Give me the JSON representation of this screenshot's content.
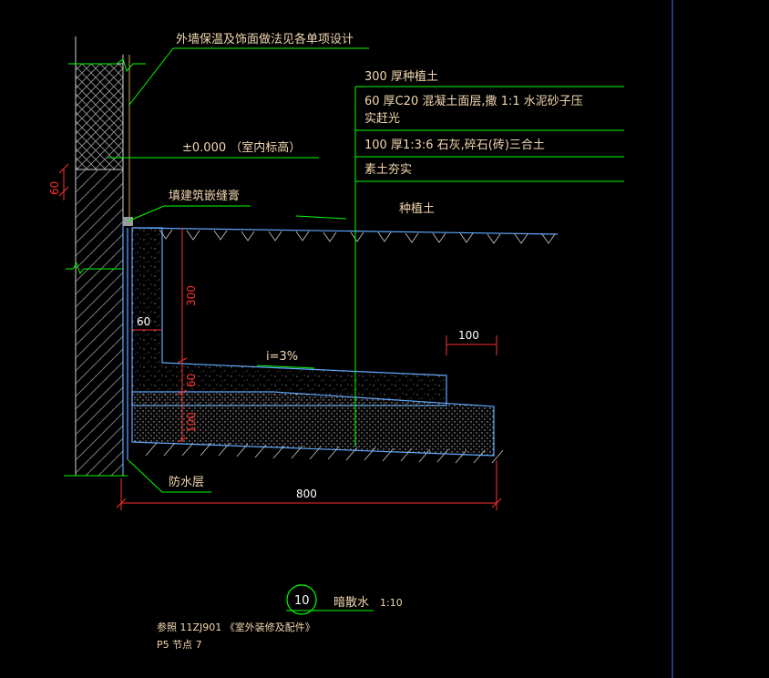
{
  "notes": {
    "wall_finish": "外墙保温及饰面做法见各单项设计",
    "floor_level": "±0.000 （室内标高）",
    "joint": "填建筑嵌缝膏",
    "waterproof": "防水层",
    "planting_soil": "种植土",
    "slope": "i=3%"
  },
  "layers": [
    "300 厚种植土",
    "60 厚C20 混凝土面层,撒  1:1 水泥砂子压",
    "实赶光",
    "100 厚1:3:6  石灰,碎石(砖)三合土",
    "素土夯实"
  ],
  "dimensions": {
    "wall_top": "60",
    "height_300": "300",
    "height_60": "60",
    "height_100": "100",
    "width_60": "60",
    "width_100": "100",
    "width_800": "800"
  },
  "title": {
    "number": "10",
    "name": "暗散水",
    "scale": "1:10"
  },
  "reference": {
    "line1": "参照 11ZJ901 《室外装修及配件》",
    "line2": "P5  节点 7"
  },
  "colors": {
    "background": "#000000",
    "leader": "#00ff00",
    "concrete": "#5fa8ff",
    "dimension": "#ff3030",
    "text": "#f3d7b0",
    "frame": "#3a78ff"
  }
}
